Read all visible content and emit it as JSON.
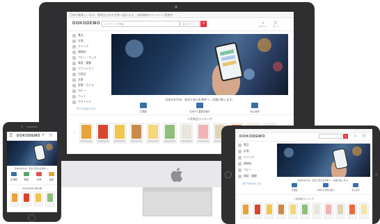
{
  "desktop": {
    "topbar_text": "日本の美味しいもの、便利なものを世界へ届けます。 送料無料キャンペーン実施中",
    "logo": "DOKODEMO",
    "search_placeholder": "キーワードで検索",
    "search_category": "全カテゴリ",
    "header_icons": [
      "ログイン",
      "カート"
    ],
    "sidebar_items": [
      "食品",
      "お酒",
      "ドリンク",
      "調味料",
      "ベビー・キッズ",
      "美容・健康",
      "ファッション",
      "日用品",
      "文具",
      "家電・カメラ",
      "ホビー",
      "ペット",
      "アウトドア"
    ],
    "sidebar_more": "すべてのカテゴリ",
    "hero_tagline": "日本のおかみ、安全と安心を海外へ、お届け致します。",
    "features": [
      "正規品",
      "日本から直接お届け",
      "安心決済"
    ],
    "ranking_title": "人気商品ランキング"
  },
  "phone": {
    "logo": "DOKODEMO",
    "hero_text": "日本のおかみ、安全と安心を海外へ。",
    "icons": [
      "正規品",
      "配送",
      "決済",
      "返品"
    ],
    "ranking_title": "DOKODEMO売れ筋",
    "menu_icon": "hamburger-icon"
  },
  "tablet": {
    "logo": "DOKODEMO",
    "sidebar_items": [
      "食品",
      "お酒",
      "ドリンク",
      "調味料",
      "ベビー",
      "美容・健康"
    ],
    "sidebar_more": "すべてのカテゴリ",
    "hero_tagline": "日本のおかみ、安全と安心を海外へ、お届け致します。",
    "features": [
      "正規品",
      "日本から直接お届け",
      "安心決済"
    ],
    "ranking_title": "人気商品ランキング"
  },
  "colors": {
    "accent": "#e8313a",
    "device_frame": "#2f2f31",
    "feature_icon": "#3a6fa8"
  }
}
